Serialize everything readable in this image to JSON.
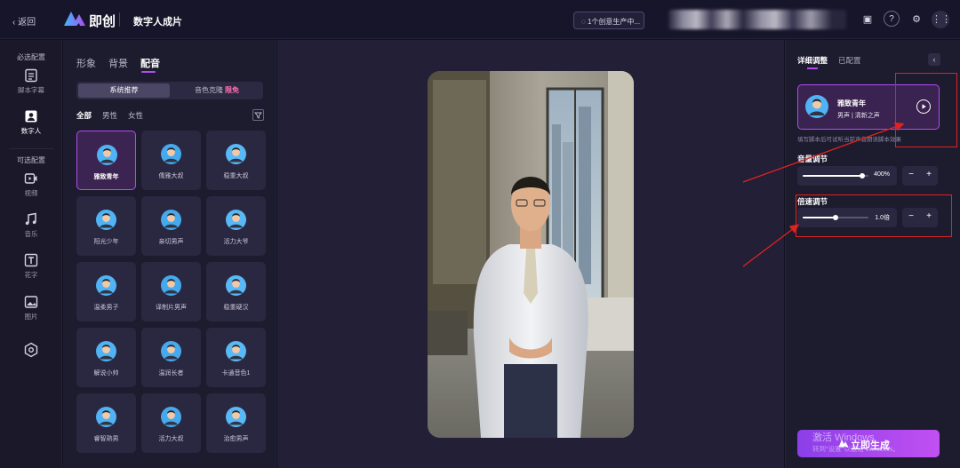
{
  "topbar": {
    "back_label": "‹ 返回",
    "brand": "即创",
    "page_title": "数字人成片",
    "task_status": "1个创意生产中..."
  },
  "leftnav": {
    "required_group": "必选配置",
    "optional_group": "可选配置",
    "items": [
      {
        "label": "脚本字幕",
        "icon": "script-icon"
      },
      {
        "label": "数字人",
        "icon": "avatar-icon"
      },
      {
        "label": "视频",
        "icon": "video-icon"
      },
      {
        "label": "音乐",
        "icon": "music-icon"
      },
      {
        "label": "花字",
        "icon": "text-effect-icon"
      },
      {
        "label": "图片",
        "icon": "image-icon"
      },
      {
        "label": "",
        "icon": "settings-hex-icon"
      }
    ]
  },
  "panel": {
    "tabs": [
      "形象",
      "背景",
      "配音"
    ],
    "active_tab": "配音",
    "segment": {
      "recommended": "系统推荐",
      "clone": "音色克隆",
      "limited_badge": "限免"
    },
    "filters": [
      "全部",
      "男性",
      "女性"
    ],
    "voices": [
      "雅致青年",
      "儒雅大叔",
      "稳重大叔",
      "阳光少年",
      "亲切男声",
      "活力大爷",
      "温柔男子",
      "译制片男声",
      "稳重硬汉",
      "解说小帅",
      "温润长者",
      "卡通音色1",
      "睿智熟男",
      "活力大叔",
      "治愈男声"
    ],
    "selected_voice": "雅致青年"
  },
  "rpanel": {
    "tabs": [
      "详细调整",
      "已配置"
    ],
    "voice_card": {
      "name": "雅致青年",
      "tags": "男声 | 清新之声"
    },
    "hint": "填写脚本后可试听当前声音朗读脚本效果",
    "volume": {
      "label": "音量调节",
      "value_text": "400%",
      "level": 0.9
    },
    "speed": {
      "label": "倍速调节",
      "value_text": "1.0倍",
      "level": 0.5
    },
    "generate_label": "立即生成",
    "watermark_line1": "激活 Windows",
    "watermark_line2": "转到\"设置\"以激活 Windows。"
  },
  "colors": {
    "accent": "#b14cf0",
    "annotation": "#e0231f",
    "background": "#141221"
  }
}
